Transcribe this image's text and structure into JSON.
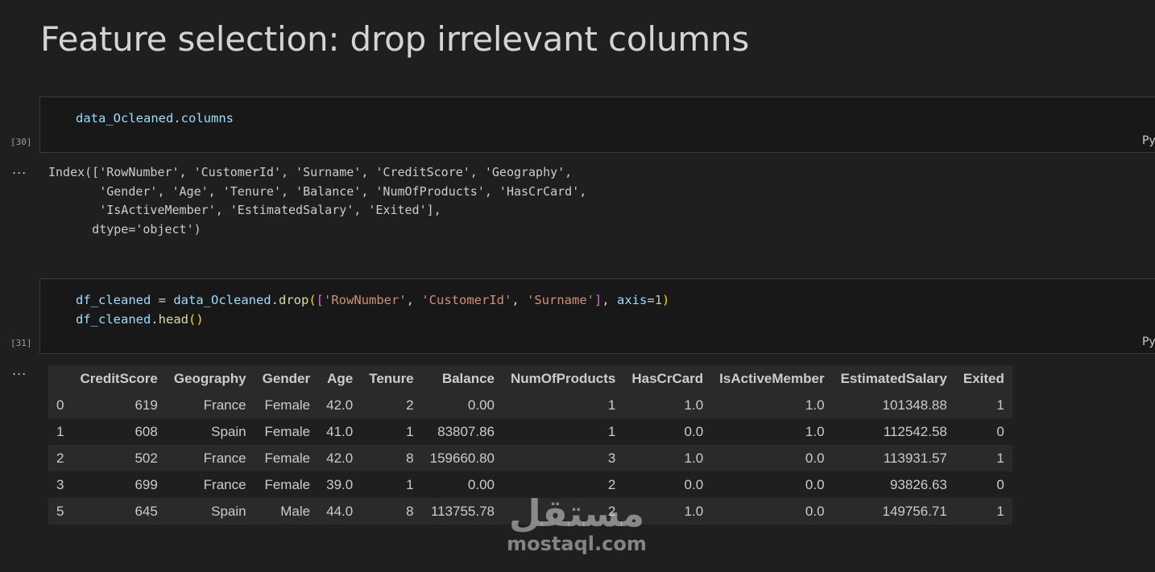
{
  "heading": "Feature selection: drop irrelevant columns",
  "cells": [
    {
      "exec_count": "[30]",
      "language": "Python",
      "code_tokens": [
        [
          {
            "t": "data_Ocleaned",
            "c": "var"
          },
          {
            "t": ".",
            "c": "op"
          },
          {
            "t": "columns",
            "c": "var"
          }
        ]
      ],
      "output_dots": "...",
      "output_text": [
        "Index(['RowNumber', 'CustomerId', 'Surname', 'CreditScore', 'Geography',",
        "       'Gender', 'Age', 'Tenure', 'Balance', 'NumOfProducts', 'HasCrCard',",
        "       'IsActiveMember', 'EstimatedSalary', 'Exited'],",
        "      dtype='object')"
      ]
    },
    {
      "exec_count": "[31]",
      "language": "Python",
      "code_tokens": [
        [
          {
            "t": "df_cleaned",
            "c": "var"
          },
          {
            "t": " = ",
            "c": "op"
          },
          {
            "t": "data_Ocleaned",
            "c": "var"
          },
          {
            "t": ".",
            "c": "op"
          },
          {
            "t": "drop",
            "c": "fn"
          },
          {
            "t": "(",
            "c": "br1"
          },
          {
            "t": "[",
            "c": "br2"
          },
          {
            "t": "'RowNumber'",
            "c": "str"
          },
          {
            "t": ", ",
            "c": "op"
          },
          {
            "t": "'CustomerId'",
            "c": "str"
          },
          {
            "t": ", ",
            "c": "op"
          },
          {
            "t": "'Surname'",
            "c": "str"
          },
          {
            "t": "]",
            "c": "br2"
          },
          {
            "t": ", ",
            "c": "op"
          },
          {
            "t": "axis",
            "c": "var"
          },
          {
            "t": "=",
            "c": "op"
          },
          {
            "t": "1",
            "c": "num"
          },
          {
            "t": ")",
            "c": "br1"
          }
        ],
        [
          {
            "t": "df_cleaned",
            "c": "var"
          },
          {
            "t": ".",
            "c": "op"
          },
          {
            "t": "head",
            "c": "fn"
          },
          {
            "t": "()",
            "c": "br1"
          }
        ]
      ],
      "output_dots": "..."
    }
  ],
  "table": {
    "columns": [
      "",
      "CreditScore",
      "Geography",
      "Gender",
      "Age",
      "Tenure",
      "Balance",
      "NumOfProducts",
      "HasCrCard",
      "IsActiveMember",
      "EstimatedSalary",
      "Exited"
    ],
    "rows": [
      [
        "0",
        "619",
        "France",
        "Female",
        "42.0",
        "2",
        "0.00",
        "1",
        "1.0",
        "1.0",
        "101348.88",
        "1"
      ],
      [
        "1",
        "608",
        "Spain",
        "Female",
        "41.0",
        "1",
        "83807.86",
        "1",
        "0.0",
        "1.0",
        "112542.58",
        "0"
      ],
      [
        "2",
        "502",
        "France",
        "Female",
        "42.0",
        "8",
        "159660.80",
        "3",
        "1.0",
        "0.0",
        "113931.57",
        "1"
      ],
      [
        "3",
        "699",
        "France",
        "Female",
        "39.0",
        "1",
        "0.00",
        "2",
        "0.0",
        "0.0",
        "93826.63",
        "0"
      ],
      [
        "5",
        "645",
        "Spain",
        "Male",
        "44.0",
        "8",
        "113755.78",
        "2",
        "1.0",
        "0.0",
        "149756.71",
        "1"
      ]
    ]
  },
  "watermark": {
    "arabic": "مستقل",
    "latin": "mostaql.com"
  }
}
